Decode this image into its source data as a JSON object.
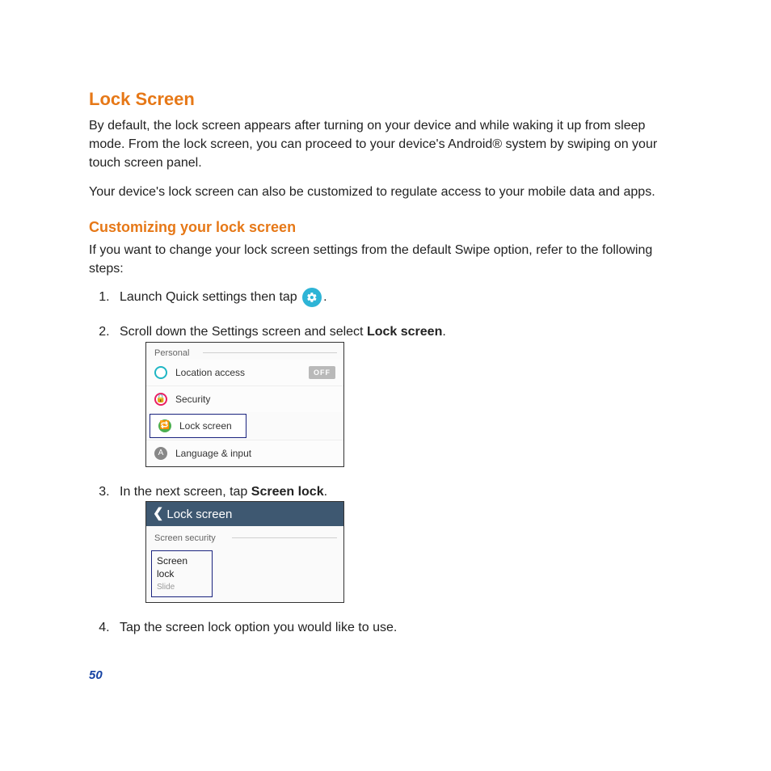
{
  "title": "Lock Screen",
  "intro1": "By default, the lock screen appears after turning on your device and while waking it up from sleep mode. From the lock screen, you can proceed to your device's Android® system by swiping on your touch screen panel.",
  "intro2": "Your device's lock screen can also be customized to regulate access to your mobile data and apps.",
  "subhead": "Customizing your lock screen",
  "subintro": "If you want to change your lock screen settings from the default Swipe option, refer to the following steps:",
  "steps": {
    "s1a": "Launch Quick settings then tap ",
    "s1b": ".",
    "s2a": "Scroll down the Settings screen and select ",
    "s2b": "Lock screen",
    "s2c": ".",
    "s3a": "In the next screen, tap ",
    "s3b": "Screen lock",
    "s3c": ".",
    "s4": "Tap the screen lock option you would like to use."
  },
  "shot1": {
    "section": "Personal",
    "item1": "Location access",
    "item1_toggle": "OFF",
    "item2": "Security",
    "item3": "Lock screen",
    "item4": "Language & input"
  },
  "shot2": {
    "header": "Lock screen",
    "section": "Screen security",
    "item_title": "Screen lock",
    "item_sub": "Slide"
  },
  "page_number": "50"
}
